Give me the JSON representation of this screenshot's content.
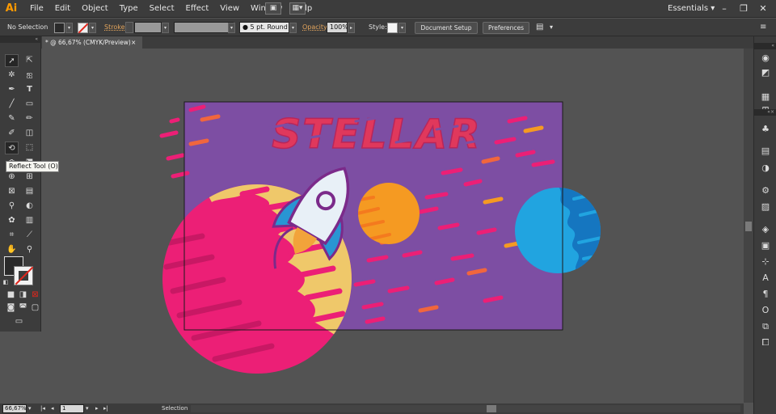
{
  "app": {
    "logo": "Ai",
    "workspace": "Essentials",
    "workspace_arrow": "▾"
  },
  "menus": [
    "File",
    "Edit",
    "Object",
    "Type",
    "Select",
    "Effect",
    "View",
    "Window",
    "Help"
  ],
  "window_controls": [
    "–",
    "❐",
    "✕"
  ],
  "control_bar": {
    "selection": "No Selection",
    "stroke_label": "Stroke:",
    "brush": "5 pt. Round",
    "opacity_label": "Opacity:",
    "opacity_value": "100%",
    "style_label": "Style:",
    "doc_setup": "Document Setup",
    "preferences": "Preferences"
  },
  "document_tab": {
    "title": "* @ 66,67% (CMYK/Preview)",
    "close": "×"
  },
  "tooltip": "Reflect Tool (O)",
  "artwork": {
    "headline": "STELLAR"
  },
  "status_bar": {
    "zoom": "66,67%",
    "artboard": "1",
    "mode": "Selection"
  },
  "colors": {
    "chrome": "#3c3c3c",
    "pasteboard": "#535353",
    "artboard_bg": "#7d4ea3",
    "pink": "#ec1f76",
    "yellow": "#efc86a",
    "orange": "#f59a22",
    "blue": "#21a4e0",
    "rocket_white": "#e8f0f7",
    "rocket_blue": "#2995d3",
    "accent_ui": "#ff9a00"
  },
  "icons": {
    "tools": [
      "selection-tool-icon",
      "direct-selection-tool-icon",
      "magic-wand-icon",
      "lasso-icon",
      "pen-icon",
      "type-icon",
      "line-icon",
      "rectangle-icon",
      "paintbrush-icon",
      "pencil-icon",
      "shaper-icon",
      "eraser-icon",
      "rotate-icon",
      "scale-icon",
      "width-icon",
      "free-transform-icon",
      "shape-builder-icon",
      "perspective-grid-icon",
      "mesh-icon",
      "gradient-icon",
      "eyedropper-icon",
      "blend-icon",
      "symbol-sprayer-icon",
      "column-graph-icon",
      "artboard-icon",
      "slice-icon",
      "hand-icon",
      "zoom-icon"
    ],
    "right_panel": [
      "color-icon",
      "color-guide-icon",
      "swatches-icon",
      "symbols-icon",
      "stroke-icon",
      "gradient-icon",
      "transparency-icon",
      "appearance-icon",
      "graphic-styles-icon",
      "layers-icon",
      "artboards-icon",
      "transform-icon",
      "character-icon",
      "paragraph-icon",
      "opentype-icon",
      "pathfinder-icon",
      "align-icon"
    ]
  }
}
